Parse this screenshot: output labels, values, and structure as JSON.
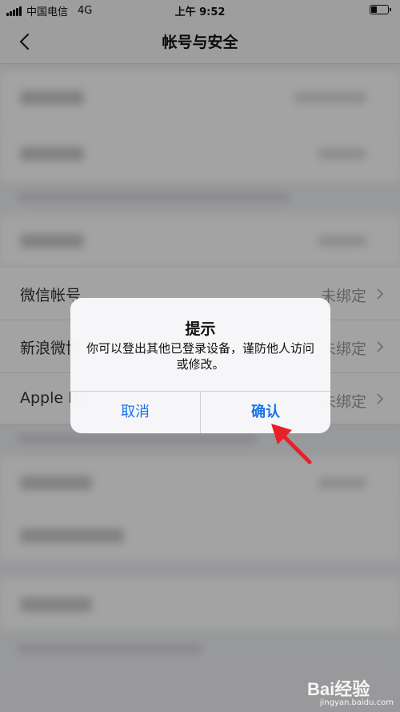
{
  "status_bar": {
    "carrier": "中国电信",
    "network": "4G",
    "time": "上午 9:52",
    "battery_level": 0.35
  },
  "nav": {
    "back_icon": "chevron-left-icon",
    "title": "帐号与安全"
  },
  "settings": {
    "wechat_label": "微信帐号",
    "wechat_status": "未绑定",
    "weibo_label": "新浪微博",
    "weibo_status": "未绑定",
    "apple_label": "Apple ID",
    "apple_status": "未绑定"
  },
  "dialog": {
    "title": "提示",
    "message": "你可以登出其他已登录设备，谨防他人访问或修改。",
    "cancel_label": "取消",
    "confirm_label": "确认"
  },
  "watermark": {
    "logo": "Bai经验",
    "url": "jingyan.baidu.com"
  },
  "colors": {
    "accent": "#1a73e8",
    "annotation_arrow": "#e8202a"
  }
}
